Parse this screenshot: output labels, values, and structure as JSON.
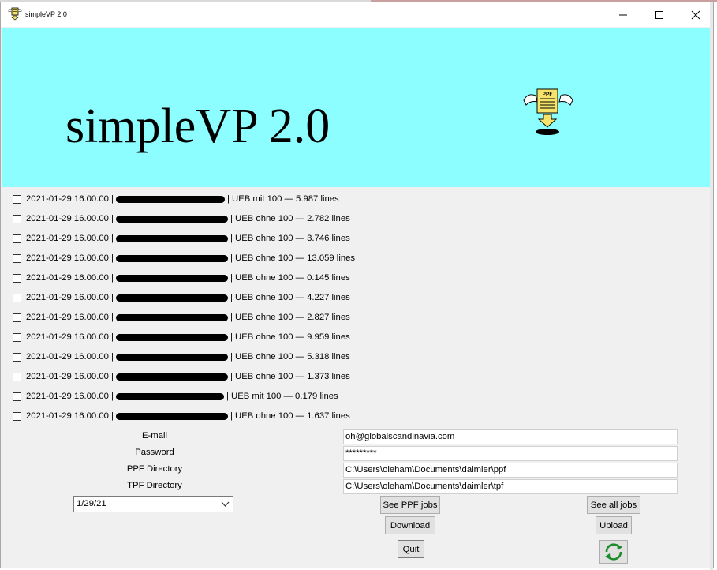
{
  "window": {
    "title": "simpleVP 2.0"
  },
  "banner": {
    "title": "simpleVP 2.0",
    "background_color": "#8cfeff",
    "logo_icon": "ppf-download-icon",
    "logo_text": "PPF"
  },
  "jobs": [
    {
      "date": "2021-01-29 16.00.00 |",
      "suffix": "| UEB mit 100 — 5.987 lines",
      "checked": false
    },
    {
      "date": "2021-01-29 16.00.00 |",
      "suffix": "| UEB ohne 100 — 2.782 lines",
      "checked": false
    },
    {
      "date": "2021-01-29 16.00.00 |",
      "suffix": "| UEB ohne 100 — 3.746 lines",
      "checked": false
    },
    {
      "date": "2021-01-29 16.00.00 |",
      "suffix": "| UEB ohne 100 — 13.059 lines",
      "checked": false
    },
    {
      "date": "2021-01-29 16.00.00 |",
      "suffix": "| UEB ohne 100 — 0.145 lines",
      "checked": false
    },
    {
      "date": "2021-01-29 16.00.00 |",
      "suffix": "| UEB ohne 100 — 4.227 lines",
      "checked": false
    },
    {
      "date": "2021-01-29 16.00.00 |",
      "suffix": "| UEB ohne 100 — 2.827 lines",
      "checked": false
    },
    {
      "date": "2021-01-29 16.00.00 |",
      "suffix": "| UEB ohne 100 — 9.959 lines",
      "checked": false
    },
    {
      "date": "2021-01-29 16.00.00 |",
      "suffix": "| UEB ohne 100 — 5.318 lines",
      "checked": false
    },
    {
      "date": "2021-01-29 16.00.00 |",
      "suffix": "| UEB ohne 100 — 1.373 lines",
      "checked": false
    },
    {
      "date": "2021-01-29 16.00.00 |",
      "suffix": "| UEB mit 100 — 0.179 lines",
      "checked": false
    },
    {
      "date": "2021-01-29 16.00.00 |",
      "suffix": "| UEB ohne 100 — 1.637 lines",
      "checked": false
    }
  ],
  "form": {
    "email_label": "E-mail",
    "email_value": "oh@globalscandinavia.com",
    "password_label": "Password",
    "password_value": "*********",
    "ppf_label": "PPF Directory",
    "ppf_value": "C:\\Users\\oleham\\Documents\\daimler\\ppf",
    "tpf_label": "TPF Directory",
    "tpf_value": "C:\\Users\\oleham\\Documents\\daimler\\tpf"
  },
  "date_select": {
    "value": "1/29/21"
  },
  "buttons": {
    "see_ppf_jobs": "See PPF jobs",
    "see_all_jobs": "See all jobs",
    "download": "Download",
    "upload": "Upload",
    "quit": "Quit"
  },
  "refresh_icon": "refresh-icon",
  "accent_colors": {
    "refresh_green": "#1a8a2a"
  }
}
